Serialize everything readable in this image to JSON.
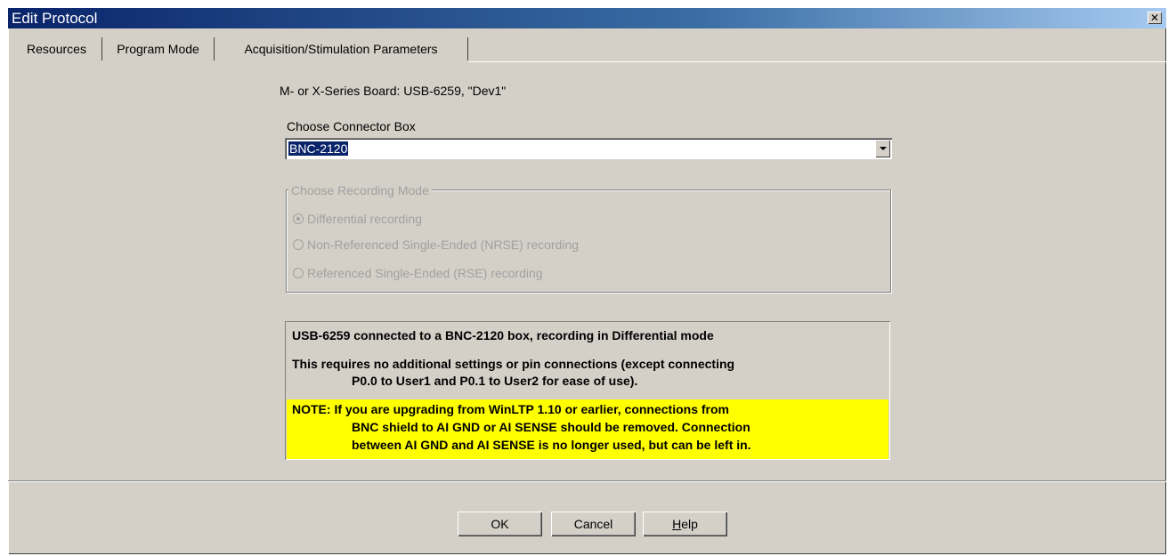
{
  "window": {
    "title": "Edit Protocol",
    "close_label": "x"
  },
  "tabs": [
    {
      "label": "Resources",
      "active": true
    },
    {
      "label": "Program Mode",
      "active": false
    },
    {
      "label": "Acquisition/Stimulation Parameters",
      "active": false
    }
  ],
  "board": {
    "text": "M- or X-Series Board:  USB-6259,  \"Dev1\""
  },
  "connector": {
    "label": "Choose Connector Box",
    "selected": "BNC-2120"
  },
  "recording_mode": {
    "title": "Choose Recording Mode",
    "enabled": false,
    "options": [
      {
        "label": "Differential recording",
        "checked": true
      },
      {
        "label": "Non-Referenced Single-Ended (NRSE) recording",
        "checked": false
      },
      {
        "label": "Referenced Single-Ended (RSE) recording",
        "checked": false
      }
    ]
  },
  "info": {
    "line1": "USB-6259 connected to a BNC-2120 box, recording in Differential mode",
    "line2": "This requires no additional settings or pin connections (except connecting",
    "line3": "P0.0 to User1 and P0.1 to User2 for ease of use).",
    "note_line1": "NOTE: If you are upgrading from WinLTP 1.10 or earlier, connections from",
    "note_line2": "BNC shield to AI GND or AI SENSE should be removed. Connection",
    "note_line3": "between AI GND and AI SENSE is no longer used, but can be left in.",
    "note_color": "#ffff00"
  },
  "buttons": {
    "ok": "OK",
    "cancel": "Cancel",
    "help_first": "H",
    "help_rest": "elp"
  }
}
